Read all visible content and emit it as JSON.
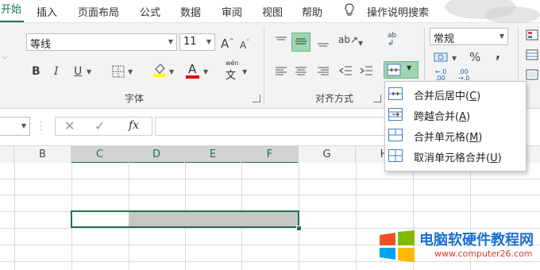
{
  "tabs": {
    "home": "开始",
    "insert": "插入",
    "page_layout": "页面布局",
    "formulas": "公式",
    "data": "数据",
    "review": "审阅",
    "view": "视图",
    "help": "帮助",
    "tell_me": "操作说明搜索"
  },
  "font": {
    "name": "等线",
    "size": "11",
    "group_label": "字体",
    "bold": "B",
    "italic": "I",
    "underline": "U",
    "grow": "A",
    "shrink": "A",
    "font_color": "A",
    "phonetic": "wén"
  },
  "alignment": {
    "group_label": "对齐方式",
    "wrap_text": "ab"
  },
  "number": {
    "format": "常规",
    "percent": "%",
    "comma": ",",
    "inc_decimal": ".0",
    "dec_decimal": ".00"
  },
  "formula_bar": {
    "fx": "fx",
    "cancel": "✕",
    "enter": "✓"
  },
  "columns": [
    "B",
    "C",
    "D",
    "E",
    "F",
    "G",
    "H"
  ],
  "merge_menu": {
    "items": [
      {
        "label": "合并后居中(",
        "key": "C",
        "suffix": ")"
      },
      {
        "label": "跨越合并(",
        "key": "A",
        "suffix": ")"
      },
      {
        "label": "合并单元格(",
        "key": "M",
        "suffix": ")"
      },
      {
        "label": "取消单元格合并(",
        "key": "U",
        "suffix": ")"
      }
    ]
  },
  "watermark": {
    "title": "电脑软硬件教程网",
    "url": "www.computer26.com",
    "colors": [
      "#f25022",
      "#7fba00",
      "#00a4ef",
      "#ffb900"
    ]
  },
  "colors": {
    "accent": "#217346",
    "menu_icon": "#3f7fbf",
    "selection_fill": "#c6c6c6",
    "font_color_bar": "#e00000",
    "fill_color_bar": "#ffff00"
  }
}
